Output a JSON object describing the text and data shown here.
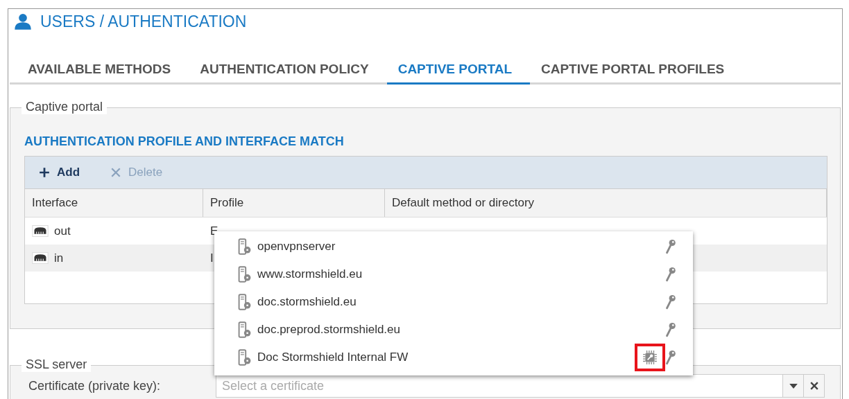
{
  "header": {
    "title": "USERS / AUTHENTICATION"
  },
  "tabs": [
    {
      "label": "AVAILABLE METHODS",
      "selected": false
    },
    {
      "label": "AUTHENTICATION POLICY",
      "selected": false
    },
    {
      "label": "CAPTIVE PORTAL",
      "selected": true
    },
    {
      "label": "CAPTIVE PORTAL PROFILES",
      "selected": false
    }
  ],
  "captive_portal": {
    "legend": "Captive portal",
    "section_title": "AUTHENTICATION PROFILE AND INTERFACE MATCH",
    "toolbar": [
      {
        "label": "Add",
        "kind": "add",
        "disabled": false
      },
      {
        "label": "Delete",
        "kind": "delete",
        "disabled": true
      }
    ],
    "table": {
      "columns": [
        "Interface",
        "Profile",
        "Default method or directory"
      ],
      "rows": [
        {
          "interface": "out",
          "profile": "E"
        },
        {
          "interface": "in",
          "profile": "I"
        }
      ]
    }
  },
  "certificate_dropdown": {
    "items": [
      {
        "label": "openvpnserver",
        "tpm": false,
        "highlighted": false
      },
      {
        "label": "www.stormshield.eu",
        "tpm": false,
        "highlighted": false
      },
      {
        "label": "doc.stormshield.eu",
        "tpm": false,
        "highlighted": false
      },
      {
        "label": "doc.preprod.stormshield.eu",
        "tpm": false,
        "highlighted": false
      },
      {
        "label": "Doc Stormshield Internal FW",
        "tpm": true,
        "highlighted": true
      }
    ]
  },
  "ssl_server": {
    "legend": "SSL server",
    "certificate_label": "Certificate (private key):",
    "placeholder": "Select a certificate"
  }
}
